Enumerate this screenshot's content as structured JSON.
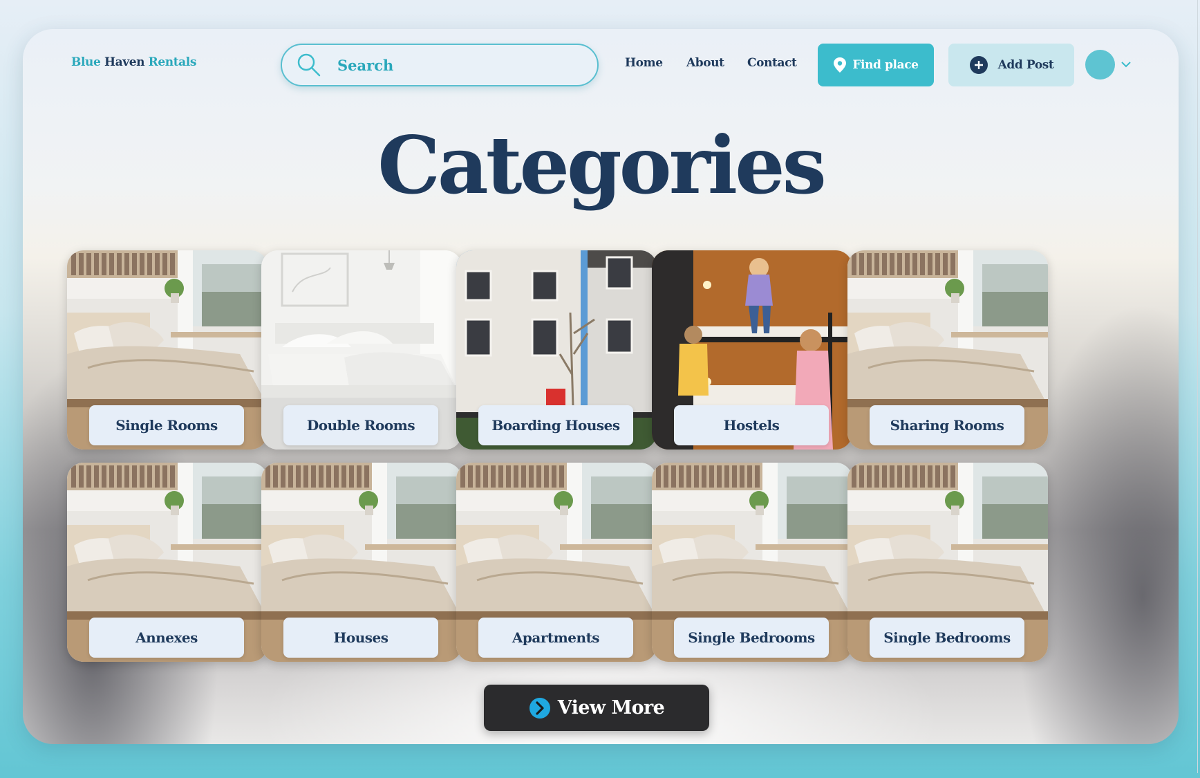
{
  "header": {
    "brand": {
      "part1": "Blue",
      "part2": "Haven",
      "part3": "Rentals"
    },
    "search_placeholder": "Search",
    "nav": [
      "Home",
      "About",
      "Contact"
    ],
    "find_label": "Find place",
    "add_label": "Add Post"
  },
  "main": {
    "title": "Categories",
    "categories": [
      {
        "label": "Single Rooms",
        "image": "bedroom"
      },
      {
        "label": "Double Rooms",
        "image": "white-bedroom"
      },
      {
        "label": "Boarding Houses",
        "image": "townhouse"
      },
      {
        "label": "Hostels",
        "image": "bunk-room"
      },
      {
        "label": "Sharing Rooms",
        "image": "bedroom"
      },
      {
        "label": "Annexes",
        "image": "bedroom"
      },
      {
        "label": "Houses",
        "image": "bedroom"
      },
      {
        "label": "Apartments",
        "image": "bedroom"
      },
      {
        "label": "Single Bedrooms",
        "image": "bedroom"
      },
      {
        "label": "Single Bedrooms",
        "image": "bedroom"
      }
    ],
    "view_more_label": "View More"
  },
  "colors": {
    "accent": "#3cbccc",
    "brand_dark": "#1f3a5c",
    "label_bg": "#e6eef8",
    "view_more_bg": "#2b2b2d"
  }
}
